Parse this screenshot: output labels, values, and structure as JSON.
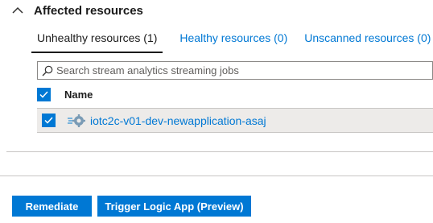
{
  "section": {
    "title": "Affected resources",
    "expanded": true
  },
  "tabs": [
    {
      "label": "Unhealthy resources (1)",
      "active": true
    },
    {
      "label": "Healthy resources (0)",
      "active": false
    },
    {
      "label": "Unscanned resources (0)",
      "active": false
    }
  ],
  "search": {
    "placeholder": "Search stream analytics streaming jobs",
    "value": ""
  },
  "table": {
    "columns": [
      "Name"
    ],
    "select_all_checked": true,
    "rows": [
      {
        "name": "iotc2c-v01-dev-newapplication-asaj",
        "checked": true,
        "icon": "stream-analytics-icon"
      }
    ]
  },
  "actions": {
    "remediate_label": "Remediate",
    "trigger_logic_app_label": "Trigger Logic App (Preview)"
  },
  "colors": {
    "accent": "#0078d4",
    "selected_row": "#edebe9",
    "text": "#1b1b1b"
  }
}
